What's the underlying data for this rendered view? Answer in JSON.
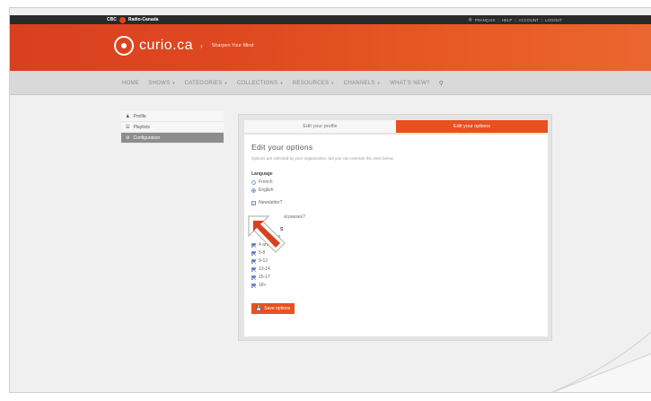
{
  "topbar": {
    "brand": "CBC",
    "brand_sub": "Radio-Canada",
    "links": [
      "FRANÇAIS",
      "HELP",
      "ACCOUNT",
      "LOGOUT"
    ]
  },
  "header": {
    "logo_text": "curio.ca",
    "tagline": "Sharpen Your Mind"
  },
  "nav": {
    "items": [
      {
        "label": "HOME",
        "caret": false
      },
      {
        "label": "SHOWS",
        "caret": true
      },
      {
        "label": "CATEGORIES",
        "caret": true
      },
      {
        "label": "COLLECTIONS",
        "caret": true
      },
      {
        "label": "RESOURCES",
        "caret": true
      },
      {
        "label": "CHANNELS",
        "caret": true
      },
      {
        "label": "WHAT'S NEW?",
        "caret": false
      }
    ],
    "search_icon": "search-icon"
  },
  "sidebar": {
    "items": [
      {
        "label": "Profile",
        "icon": "user-icon",
        "active": false
      },
      {
        "label": "Playlists",
        "icon": "list-icon",
        "active": false
      },
      {
        "label": "Configuration",
        "icon": "gear-icon",
        "active": true
      }
    ]
  },
  "tabs": [
    {
      "label": "Edit your profile",
      "active": false
    },
    {
      "label": "Edit your options",
      "active": true
    }
  ],
  "form": {
    "title": "Edit your options",
    "subtitle": "Options are selected by your organization, but you can override the ones below.",
    "language_label": "Language",
    "languages": [
      {
        "label": "French",
        "selected": false
      },
      {
        "label": "English",
        "selected": true
      }
    ],
    "newsletter_label": "Newsletter?",
    "newsletter_checked": false,
    "question_fragment": "al passes?",
    "age_heading_fragment": "S",
    "age_subheading_fragment": "Genres",
    "ages": [
      {
        "label": "4 and under",
        "checked": true
      },
      {
        "label": "5-8",
        "checked": true
      },
      {
        "label": "9-12",
        "checked": true
      },
      {
        "label": "13-14",
        "checked": true
      },
      {
        "label": "15-17",
        "checked": true
      },
      {
        "label": "18+",
        "checked": true
      }
    ],
    "save_label": "Save options"
  },
  "colors": {
    "brand_orange": "#e8501e",
    "nav_grey": "#d9d9d9",
    "active_sidebar": "#8d8d8d"
  }
}
